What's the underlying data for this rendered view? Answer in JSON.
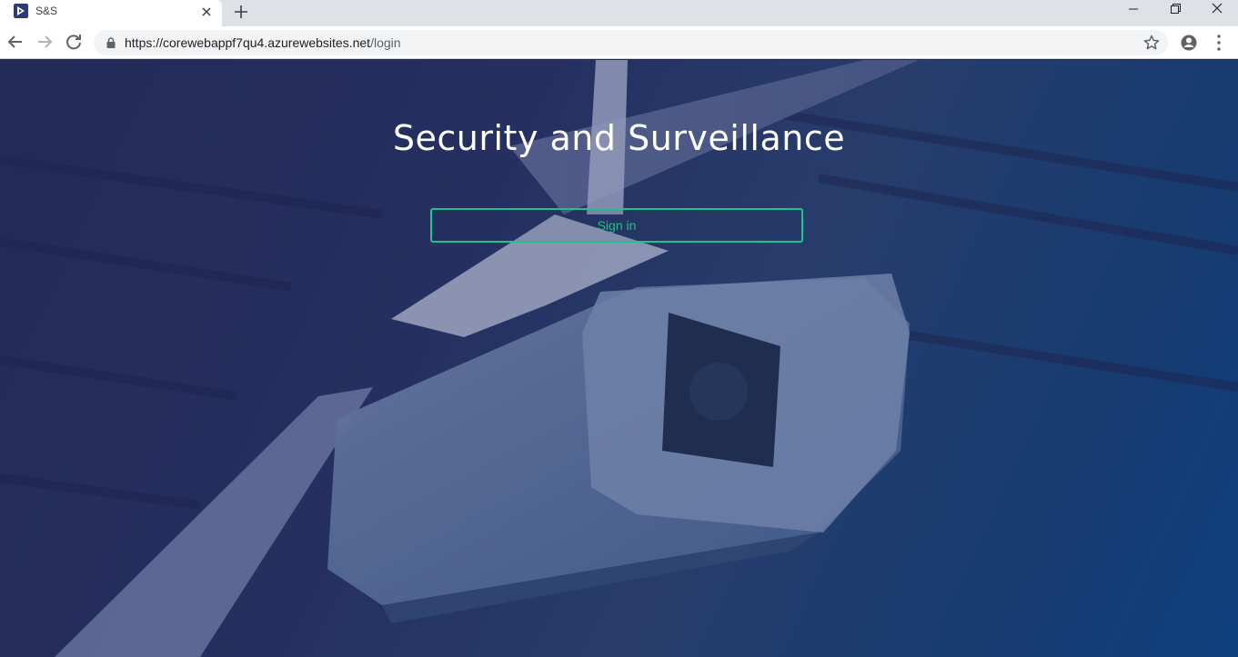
{
  "browser": {
    "tab": {
      "title": "S&S",
      "favicon": "app-logo-icon"
    },
    "url": {
      "host": "https://corewebappf7qu4.azurewebsites.net",
      "path": "/login"
    },
    "icons": [
      "back-icon",
      "forward-icon",
      "reload-icon",
      "lock-icon",
      "star-icon",
      "profile-icon",
      "menu-icon",
      "close-icon",
      "new-tab-icon",
      "minimize-icon",
      "maximize-icon",
      "window-close-icon"
    ]
  },
  "page": {
    "title": "Security and Surveillance",
    "signin_label": "Sign in"
  },
  "colors": {
    "accent": "#22c08a",
    "background_dark": "#252c5a",
    "background_blue": "#0a4a8e"
  }
}
